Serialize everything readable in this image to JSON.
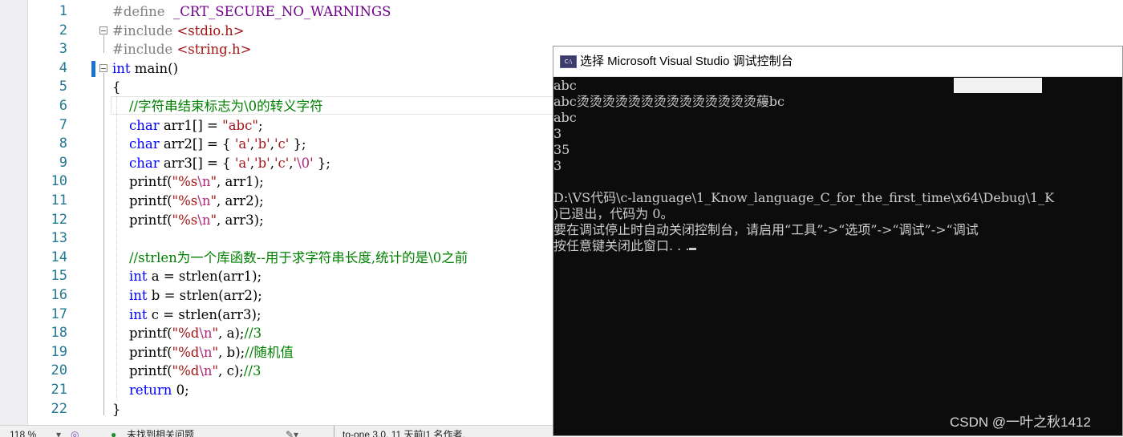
{
  "editor": {
    "line_numbers": [
      "1",
      "2",
      "3",
      "4",
      "5",
      "6",
      "7",
      "8",
      "9",
      "10",
      "11",
      "12",
      "13",
      "14",
      "15",
      "16",
      "17",
      "18",
      "19",
      "20",
      "21",
      "22"
    ],
    "lines": [
      [
        {
          "t": "#define  ",
          "c": "pp"
        },
        {
          "t": "_CRT_SECURE_NO_WARNINGS",
          "c": "mac"
        }
      ],
      [
        {
          "t": "#include ",
          "c": "pp"
        },
        {
          "t": "<stdio.h>",
          "c": "str"
        }
      ],
      [
        {
          "t": "#include ",
          "c": "pp"
        },
        {
          "t": "<string.h>",
          "c": "str"
        }
      ],
      [
        {
          "t": "int",
          "c": "kw"
        },
        {
          "t": " main()",
          "c": ""
        }
      ],
      [
        {
          "t": "{",
          "c": ""
        }
      ],
      [
        {
          "t": "    //字符串结束标志为\\0的转义字符",
          "c": "cm"
        }
      ],
      [
        {
          "t": "    ",
          "c": ""
        },
        {
          "t": "char",
          "c": "kw"
        },
        {
          "t": " arr1[] = ",
          "c": ""
        },
        {
          "t": "\"abc\"",
          "c": "str"
        },
        {
          "t": ";",
          "c": ""
        }
      ],
      [
        {
          "t": "    ",
          "c": ""
        },
        {
          "t": "char",
          "c": "kw"
        },
        {
          "t": " arr2[] = { ",
          "c": ""
        },
        {
          "t": "'a'",
          "c": "str"
        },
        {
          "t": ",",
          "c": ""
        },
        {
          "t": "'b'",
          "c": "str"
        },
        {
          "t": ",",
          "c": ""
        },
        {
          "t": "'c'",
          "c": "str"
        },
        {
          "t": " };",
          "c": ""
        }
      ],
      [
        {
          "t": "    ",
          "c": ""
        },
        {
          "t": "char",
          "c": "kw"
        },
        {
          "t": " arr3[] = { ",
          "c": ""
        },
        {
          "t": "'a'",
          "c": "str"
        },
        {
          "t": ",",
          "c": ""
        },
        {
          "t": "'b'",
          "c": "str"
        },
        {
          "t": ",",
          "c": ""
        },
        {
          "t": "'c'",
          "c": "str"
        },
        {
          "t": ",",
          "c": ""
        },
        {
          "t": "'",
          "c": "str"
        },
        {
          "t": "\\0",
          "c": "esc"
        },
        {
          "t": "'",
          "c": "str"
        },
        {
          "t": " };",
          "c": ""
        }
      ],
      [
        {
          "t": "    printf(",
          "c": ""
        },
        {
          "t": "\"%s",
          "c": "str"
        },
        {
          "t": "\\n",
          "c": "esc"
        },
        {
          "t": "\"",
          "c": "str"
        },
        {
          "t": ", arr1);",
          "c": ""
        }
      ],
      [
        {
          "t": "    printf(",
          "c": ""
        },
        {
          "t": "\"%s",
          "c": "str"
        },
        {
          "t": "\\n",
          "c": "esc"
        },
        {
          "t": "\"",
          "c": "str"
        },
        {
          "t": ", arr2);",
          "c": ""
        }
      ],
      [
        {
          "t": "    printf(",
          "c": ""
        },
        {
          "t": "\"%s",
          "c": "str"
        },
        {
          "t": "\\n",
          "c": "esc"
        },
        {
          "t": "\"",
          "c": "str"
        },
        {
          "t": ", arr3);",
          "c": ""
        }
      ],
      [
        {
          "t": "",
          "c": ""
        }
      ],
      [
        {
          "t": "    //strlen为一个库函数--用于求字符串长度,统计的是\\0之前",
          "c": "cm"
        }
      ],
      [
        {
          "t": "    ",
          "c": ""
        },
        {
          "t": "int",
          "c": "kw"
        },
        {
          "t": " a = strlen(arr1);",
          "c": ""
        }
      ],
      [
        {
          "t": "    ",
          "c": ""
        },
        {
          "t": "int",
          "c": "kw"
        },
        {
          "t": " b = strlen(arr2);",
          "c": ""
        }
      ],
      [
        {
          "t": "    ",
          "c": ""
        },
        {
          "t": "int",
          "c": "kw"
        },
        {
          "t": " c = strlen(arr3);",
          "c": ""
        }
      ],
      [
        {
          "t": "    printf(",
          "c": ""
        },
        {
          "t": "\"%d",
          "c": "str"
        },
        {
          "t": "\\n",
          "c": "esc"
        },
        {
          "t": "\"",
          "c": "str"
        },
        {
          "t": ", a);",
          "c": ""
        },
        {
          "t": "//3",
          "c": "cm"
        }
      ],
      [
        {
          "t": "    printf(",
          "c": ""
        },
        {
          "t": "\"%d",
          "c": "str"
        },
        {
          "t": "\\n",
          "c": "esc"
        },
        {
          "t": "\"",
          "c": "str"
        },
        {
          "t": ", b);",
          "c": ""
        },
        {
          "t": "//随机值",
          "c": "cm"
        }
      ],
      [
        {
          "t": "    printf(",
          "c": ""
        },
        {
          "t": "\"%d",
          "c": "str"
        },
        {
          "t": "\\n",
          "c": "esc"
        },
        {
          "t": "\"",
          "c": "str"
        },
        {
          "t": ", c);",
          "c": ""
        },
        {
          "t": "//3",
          "c": "cm"
        }
      ],
      [
        {
          "t": "    ",
          "c": ""
        },
        {
          "t": "return",
          "c": "kw"
        },
        {
          "t": " 0;",
          "c": ""
        }
      ],
      [
        {
          "t": "}",
          "c": ""
        }
      ]
    ]
  },
  "statusbar": {
    "zoom": "118 %",
    "zoom_arrow": "▾",
    "issues": "未找到相关问题",
    "blame": "to-one 3.0, 11 天前|1 名作者,"
  },
  "console": {
    "title": "选择 Microsoft Visual Studio 调试控制台",
    "icon_text": "C:\\",
    "lines": [
      "abc",
      "abc烫烫烫烫烫烫烫烫烫烫烫烫烫烫蘰bc",
      "abc",
      "3",
      "35",
      "3",
      "",
      "D:\\VS代码\\c-language\\1_Know_language_C_for_the_first_time\\x64\\Debug\\1_K",
      ")已退出，代码为 0。",
      "要在调试停止时自动关闭控制台，请启用“工具”->“选项”->“调试”->“调试",
      "按任意键关闭此窗口. . ."
    ]
  },
  "watermark": "CSDN @一叶之秋1412",
  "colors": {
    "keyword": "#0000ff",
    "string": "#a31515",
    "comment": "#008000",
    "preprocessor": "#808080",
    "macro": "#6f008a",
    "escape": "#b0267a",
    "console_bg": "#0c0c0c",
    "console_fg": "#cccccc"
  }
}
